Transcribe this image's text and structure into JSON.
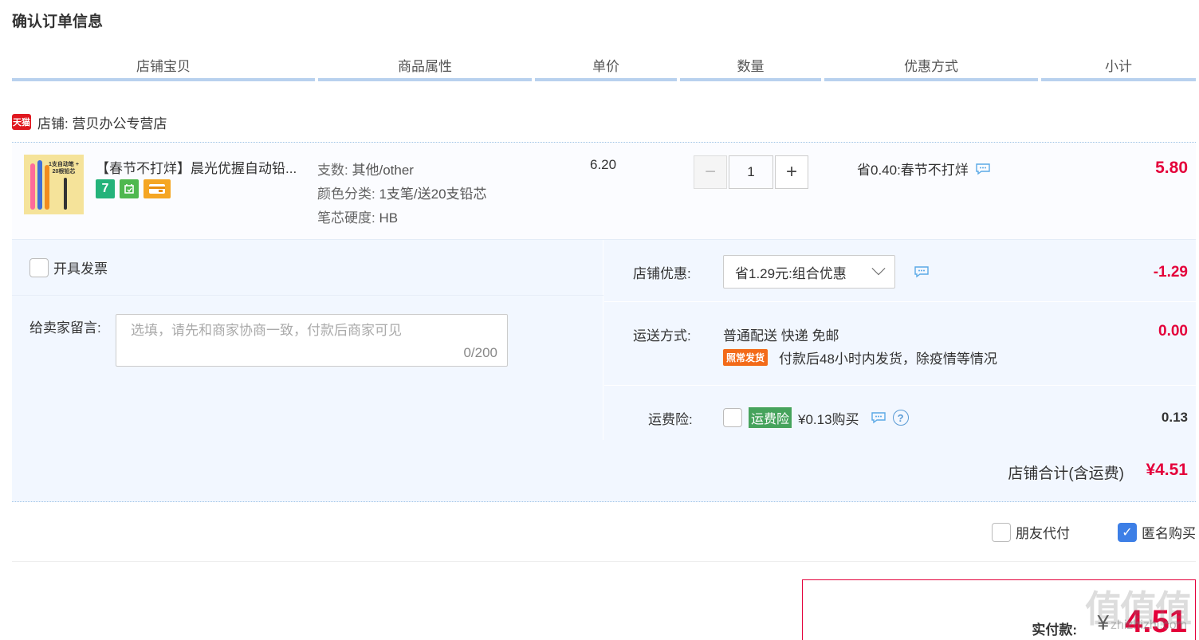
{
  "page": {
    "title": "确认订单信息"
  },
  "columns": [
    "店铺宝贝",
    "商品属性",
    "单价",
    "数量",
    "优惠方式",
    "小计"
  ],
  "shop": {
    "badge": "天猫",
    "label": "店铺: 营贝办公专营店"
  },
  "item": {
    "thumb_caption": "1支自动笔 + 20根铅芯",
    "title": "【春节不打烊】晨光优握自动铅...",
    "icons": [
      "seven-day-return-icon",
      "shipping-box-icon",
      "card-icon"
    ],
    "icon_text": {
      "seven": "7"
    },
    "props": [
      {
        "key": "支数:",
        "value": "其他/other"
      },
      {
        "key": "颜色分类:",
        "value": "1支笔/送20支铅芯"
      },
      {
        "key": "笔芯硬度:",
        "value": "HB"
      }
    ],
    "unit_price": "6.20",
    "quantity": "1",
    "qty_minus": "−",
    "qty_plus": "+",
    "discount": "省0.40:春节不打烊",
    "subtotal": "5.80"
  },
  "invoice": {
    "label": "开具发票"
  },
  "message": {
    "label": "给卖家留言:",
    "placeholder": "选填，请先和商家协商一致，付款后商家可见",
    "count": "0/200"
  },
  "shop_discount": {
    "label": "店铺优惠:",
    "selected": "省1.29元:组合优惠",
    "amount": "-1.29"
  },
  "shipping": {
    "label": "运送方式:",
    "method": "普通配送 快递 免邮",
    "badge": "照常发货",
    "note": "付款后48小时内发货，除疫情等情况",
    "amount": "0.00"
  },
  "insurance": {
    "label": "运费险:",
    "badge": "运费险",
    "price": "¥0.13购买",
    "help": "?",
    "amount": "0.13"
  },
  "shop_total": {
    "label": "店铺合计(含运费)",
    "amount": "¥4.51"
  },
  "pay_options": {
    "friend": "朋友代付",
    "anonymous": "匿名购买",
    "check": "✓"
  },
  "final": {
    "label": "实付款:",
    "yen": "¥",
    "amount": "4.51"
  },
  "watermark": {
    "main": "值值值",
    "sub": "zhizhizhi.com"
  },
  "colors": {
    "price_red": "#e4003a",
    "header_line": "#b8d1ee",
    "panel_bg": "#f2f7ff",
    "checkbox_blue": "#3d7fe6"
  }
}
